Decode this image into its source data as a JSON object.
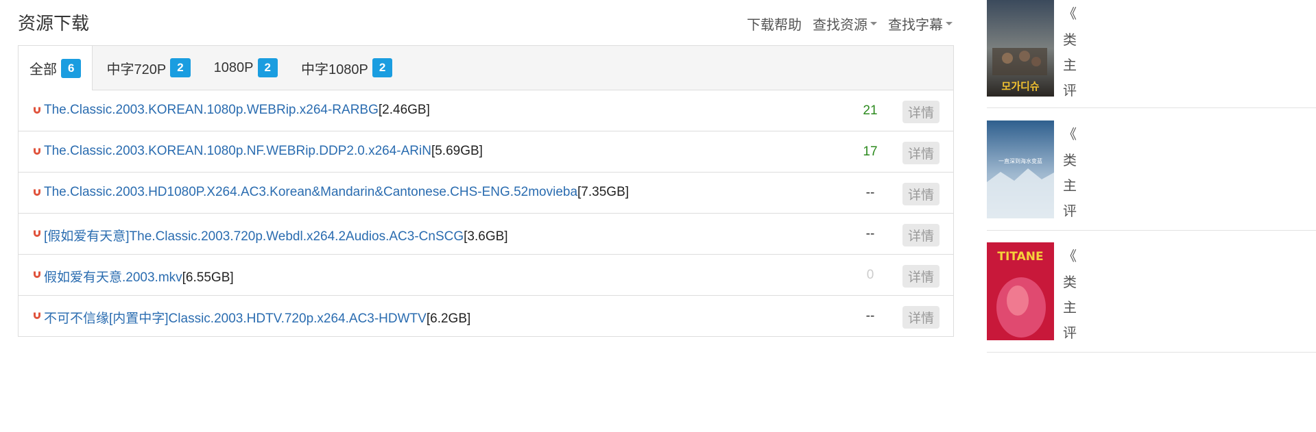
{
  "section_title": "资源下载",
  "top_links": {
    "help": "下载帮助",
    "find_resource": "查找资源",
    "find_subtitle": "查找字幕"
  },
  "tabs": [
    {
      "label": "全部",
      "count": "6"
    },
    {
      "label": "中字720P",
      "count": "2"
    },
    {
      "label": "1080P",
      "count": "2"
    },
    {
      "label": "中字1080P",
      "count": "2"
    }
  ],
  "files": [
    {
      "name": "The.Classic.2003.KOREAN.1080p.WEBRip.x264-RARBG",
      "size": "[2.46GB]",
      "seeds": "21",
      "detail": "详情"
    },
    {
      "name": "The.Classic.2003.KOREAN.1080p.NF.WEBRip.DDP2.0.x264-ARiN",
      "size": "[5.69GB]",
      "seeds": "17",
      "detail": "详情"
    },
    {
      "name": "The.Classic.2003.HD1080P.X264.AC3.Korean&Mandarin&Cantonese.CHS-ENG.52movieba",
      "size": "[7.35GB]",
      "seeds": "--",
      "detail": "详情"
    },
    {
      "name": "[假如爱有天意]The.Classic.2003.720p.Webdl.x264.2Audios.AC3-CnSCG",
      "size": "[3.6GB]",
      "seeds": "--",
      "detail": "详情"
    },
    {
      "name": "假如爱有天意.2003.mkv",
      "size": "[6.55GB]",
      "seeds": "0",
      "detail": "详情"
    },
    {
      "name": "不可不信缘[内置中字]Classic.2003.HDTV.720p.x264.AC3-HDWTV",
      "size": "[6.2GB]",
      "seeds": "--",
      "detail": "详情"
    }
  ],
  "sidebar": {
    "items": [
      {
        "open_quote": "《",
        "l1": "类",
        "l2": "主",
        "l3": "评",
        "poster_text": "모가디슈"
      },
      {
        "open_quote": "《",
        "l1": "类",
        "l2": "主",
        "l3": "评",
        "poster_text": "一直深到海水变蓝"
      },
      {
        "open_quote": "《",
        "l1": "类",
        "l2": "主",
        "l3": "评",
        "poster_text": "TITANE"
      }
    ]
  },
  "colors": {
    "link": "#2a6cb0",
    "badge": "#1a9de0",
    "seed_green": "#2c8a1e",
    "magnet": "#e0533c"
  }
}
